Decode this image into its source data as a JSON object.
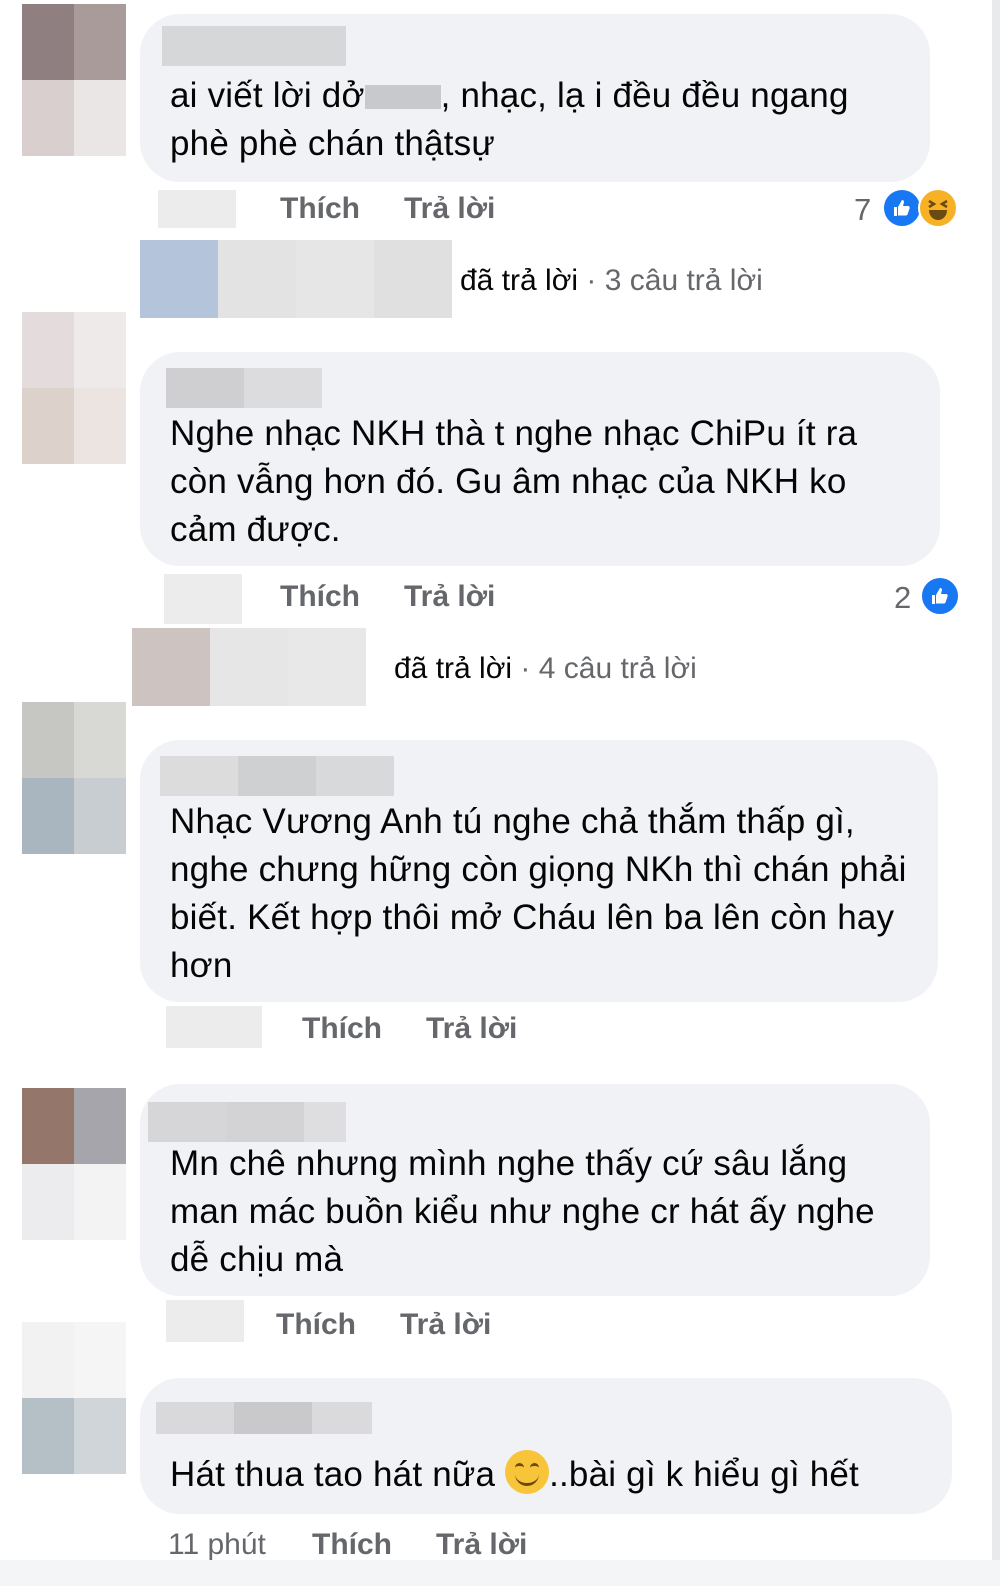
{
  "comments": [
    {
      "text_before": "ai viết lời dở",
      "text_after": ", nhạc, lạ i đều đều ngang phè phè  chán thậtsự",
      "actions": {
        "like": "Thích",
        "reply": "Trả lời"
      },
      "reactions": {
        "count": "7",
        "icons": [
          "like-icon",
          "haha-icon"
        ]
      },
      "replies": {
        "verb": "đã trả lời",
        "count": "3 câu trả lời"
      }
    },
    {
      "text": "Nghe nhạc NKH thà t nghe nhạc ChiPu ít ra còn vẫng hơn đó. Gu âm nhạc của NKH ko cảm được.",
      "actions": {
        "like": "Thích",
        "reply": "Trả lời"
      },
      "reactions": {
        "count": "2",
        "icons": [
          "like-icon"
        ]
      },
      "replies": {
        "verb": "đã trả lời",
        "count": "4 câu trả lời"
      }
    },
    {
      "text": "Nhạc Vương Anh tú nghe chả thắm thấp gì, nghe chưng hững còn giọng NKh thì chán phải biết. Kết hợp thôi mở Cháu lên ba lên còn hay hơn",
      "actions": {
        "like": "Thích",
        "reply": "Trả lời"
      }
    },
    {
      "text": "Mn chê nhưng mình nghe thấy cứ sâu lắng man mác buồn kiểu như nghe cr hát ấy nghe dễ chịu mà",
      "actions": {
        "like": "Thích",
        "reply": "Trả lời"
      }
    },
    {
      "text_before": "Hát thua tao hát nữa ",
      "text_after": "..bài gì k hiểu  gì hết",
      "emoji": "smiling-face-emoji",
      "actions": {
        "time": "11 phút",
        "like": "Thích",
        "reply": "Trả lời"
      }
    }
  ],
  "colors": {
    "bubble": "#f0f2f5",
    "action_text": "#65676b",
    "like_blue": "#1877f2",
    "haha_yellow": "#f7b125"
  }
}
